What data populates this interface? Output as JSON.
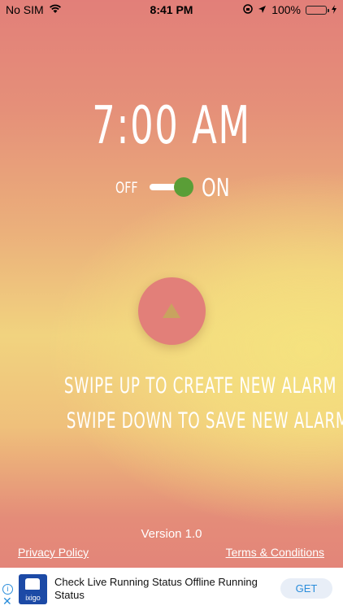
{
  "status_bar": {
    "carrier": "No SIM",
    "time": "8:41 PM",
    "battery": "100%"
  },
  "alarm": {
    "time": "7:00 AM",
    "off_label": "OFF",
    "on_label": "ON",
    "enabled": true
  },
  "instructions": {
    "line1": "SWIPE UP TO CREATE NEW ALARM",
    "line2": "SWIPE DOWN TO SAVE NEW ALARM"
  },
  "footer": {
    "version": "Version 1.0",
    "privacy": "Privacy Policy",
    "terms": "Terms & Conditions"
  },
  "ad": {
    "logo_text": "ixigo",
    "text": "Check Live Running Status Offline Running Status",
    "button": "GET"
  },
  "colors": {
    "switch_knob": "#5a9e37",
    "button": "#e27f79",
    "arrow": "#c8a35f"
  }
}
